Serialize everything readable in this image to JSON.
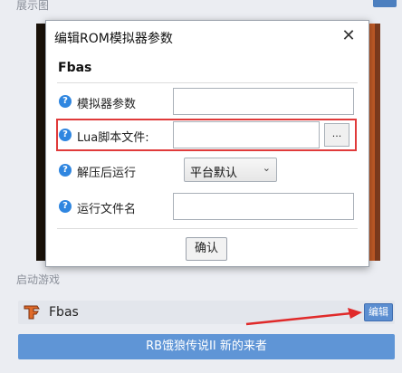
{
  "background": {
    "preview_label": "展示图",
    "launch_label": "启动游戏",
    "rom_name": "Fbas",
    "edit_label": "编辑",
    "launch_button": "RB饿狼传说II 新的来者"
  },
  "dialog": {
    "title": "编辑ROM模拟器参数",
    "close_glyph": "✕",
    "header": "Fbas",
    "fields": [
      {
        "label": "模拟器参数",
        "value": ""
      },
      {
        "label": "Lua脚本文件:",
        "value": "",
        "browse_label": "..."
      },
      {
        "label": "解压后运行",
        "selected": "平台默认"
      },
      {
        "label": "运行文件名",
        "value": ""
      }
    ],
    "confirm_label": "确认"
  },
  "colors": {
    "accent": "#5f95d6",
    "highlight": "#e03a3a",
    "help_icon": "#2f86e0"
  }
}
